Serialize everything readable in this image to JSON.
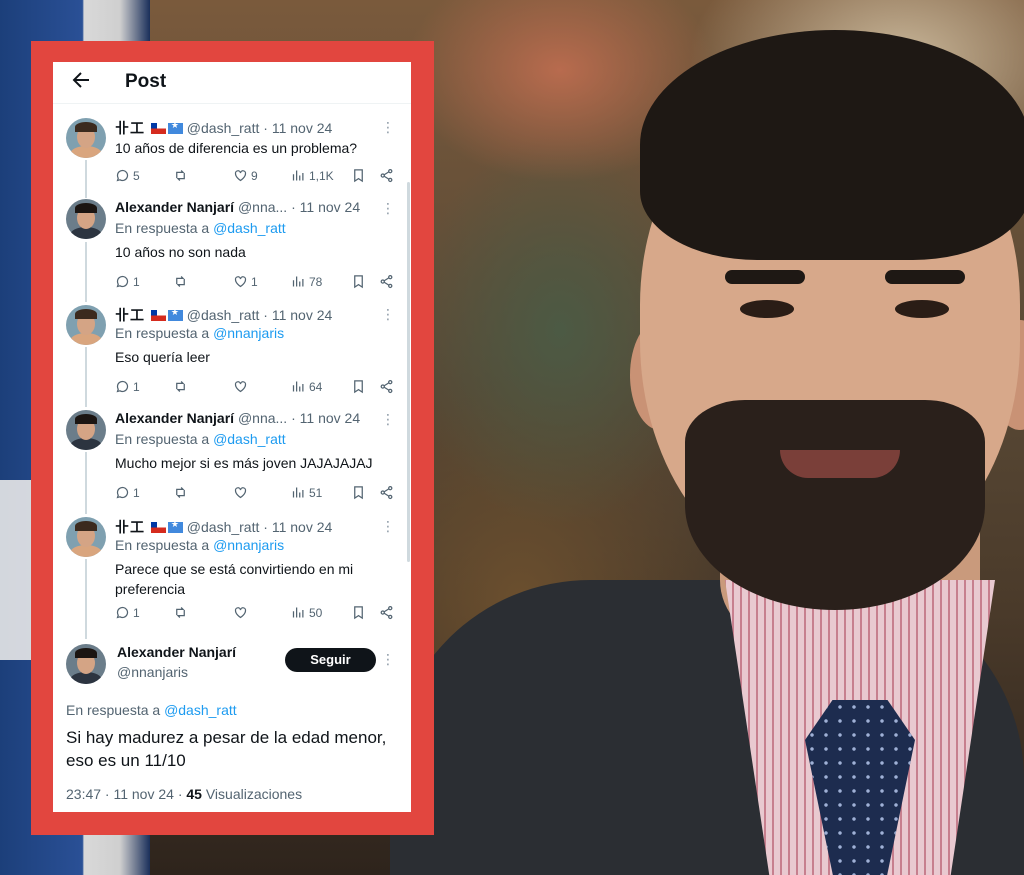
{
  "screen": {
    "title": "Post"
  },
  "thread": [
    {
      "author_glyphs": "卝工",
      "handle": "@dash_ratt",
      "date": "· 11 nov 24",
      "reply_prefix": "",
      "reply_handle": "",
      "text": "10 años de diferencia es un problema?",
      "replies": "5",
      "retweets": "",
      "likes": "9",
      "views": "1,1K"
    },
    {
      "author_name": "Alexander Nanjarí",
      "handle": "@nna...",
      "date": "· 11 nov 24",
      "reply_prefix": "En respuesta a",
      "reply_handle": "@dash_ratt",
      "text": "10 años no son nada",
      "replies": "1",
      "retweets": "",
      "likes": "1",
      "views": "78"
    },
    {
      "author_glyphs": "卝工",
      "handle": "@dash_ratt",
      "date": "· 11 nov 24",
      "reply_prefix": "En respuesta a",
      "reply_handle": "@nnanjaris",
      "text": "Eso quería leer",
      "replies": "1",
      "retweets": "",
      "likes": "",
      "views": "64"
    },
    {
      "author_name": "Alexander Nanjarí",
      "handle": "@nna...",
      "date": "· 11 nov 24",
      "reply_prefix": "En respuesta a",
      "reply_handle": "@dash_ratt",
      "text": "Mucho mejor si es más joven JAJAJAJAJ",
      "replies": "1",
      "retweets": "",
      "likes": "",
      "views": "51"
    },
    {
      "author_glyphs": "卝工",
      "handle": "@dash_ratt",
      "date": "· 11 nov 24",
      "reply_prefix": "En respuesta a",
      "reply_handle": "@nnanjaris",
      "text": "Parece que se está convirtiendo en mi preferencia",
      "replies": "1",
      "retweets": "",
      "likes": "",
      "views": "50"
    }
  ],
  "main_post": {
    "author_name": "Alexander Nanjarí",
    "handle": "@nnanjaris",
    "follow_label": "Seguir",
    "reply_prefix": "En respuesta a",
    "reply_handle": "@dash_ratt",
    "text": "Si hay madurez a pesar de la edad menor, eso es un 11/10",
    "time_date": "23:47 · 11 nov 24 ·",
    "views_count": "45",
    "views_label": "Visualizaciones"
  },
  "colors": {
    "frame": "#e2463f",
    "link": "#1d9bf0",
    "text": "#0f1419",
    "muted": "#536471"
  },
  "icons": [
    "back-arrow-icon",
    "more-icon",
    "reply-icon",
    "retweet-icon",
    "like-icon",
    "views-icon",
    "bookmark-icon",
    "share-icon"
  ]
}
